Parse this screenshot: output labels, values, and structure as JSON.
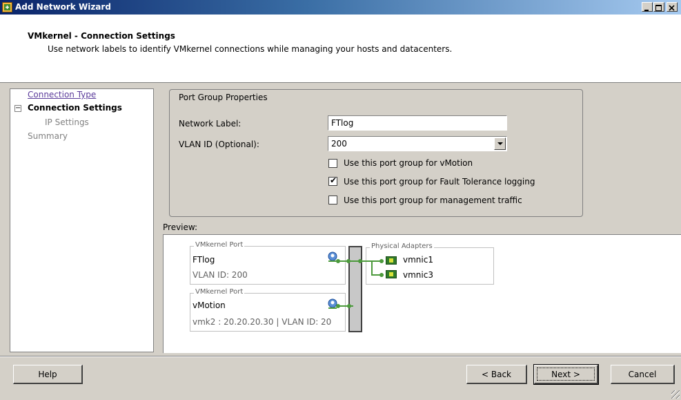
{
  "window": {
    "title": "Add Network Wizard",
    "app_icon": "vsphere-wizard-icon"
  },
  "header": {
    "title": "VMkernel - Connection Settings",
    "subtitle": "Use network labels to identify VMkernel connections while managing your hosts and datacenters."
  },
  "nav": {
    "items": [
      {
        "label": "Connection Type",
        "state": "link"
      },
      {
        "label": "Connection Settings",
        "state": "current"
      },
      {
        "label": "IP Settings",
        "state": "disabled"
      },
      {
        "label": "Summary",
        "state": "disabled"
      }
    ]
  },
  "port_group": {
    "legend": "Port Group Properties",
    "network_label": {
      "label": "Network Label:",
      "value": "FTlog"
    },
    "vlan_id": {
      "label": "VLAN ID (Optional):",
      "value": "200"
    },
    "checkboxes": [
      {
        "label": "Use this port group for vMotion",
        "checked": false
      },
      {
        "label": "Use this port group for Fault Tolerance logging",
        "checked": true
      },
      {
        "label": "Use this port group for management traffic",
        "checked": false
      }
    ]
  },
  "preview": {
    "label": "Preview:",
    "ports": [
      {
        "legend": "VMkernel Port",
        "name": "FTlog",
        "detail": "VLAN ID: 200"
      },
      {
        "legend": "VMkernel Port",
        "name": "vMotion",
        "detail": "vmk2 : 20.20.20.30 | VLAN ID: 20"
      }
    ],
    "adapters": {
      "legend": "Physical Adapters",
      "items": [
        "vmnic1",
        "vmnic3"
      ]
    },
    "colors": {
      "link": "#4c9a3c",
      "nic": "#2f7a2a"
    }
  },
  "buttons": {
    "help": "Help",
    "back": "< Back",
    "next": "Next >",
    "cancel": "Cancel"
  }
}
